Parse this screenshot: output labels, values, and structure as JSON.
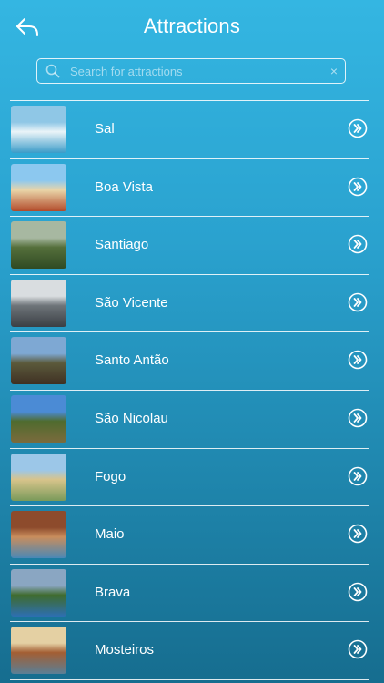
{
  "header": {
    "title": "Attractions",
    "back_icon": "back-arrow-icon"
  },
  "search": {
    "placeholder": "Search for attractions",
    "value": "",
    "clear_icon": "×"
  },
  "attractions": [
    {
      "name": "Sal",
      "thumb": [
        "#8fc7e6",
        "#eaf4f8",
        "#3a9bc8"
      ]
    },
    {
      "name": "Boa Vista",
      "thumb": [
        "#8cc8ef",
        "#e9d5a9",
        "#b24a2a"
      ]
    },
    {
      "name": "Santiago",
      "thumb": [
        "#a7b8a1",
        "#556f3b",
        "#2f4a24"
      ]
    },
    {
      "name": "São Vicente",
      "thumb": [
        "#d9dde0",
        "#6e7479",
        "#3a3f44"
      ]
    },
    {
      "name": "Santo Antão",
      "thumb": [
        "#7ea8d3",
        "#5b5a3b",
        "#3f3023"
      ]
    },
    {
      "name": "São Nicolau",
      "thumb": [
        "#4b8bd5",
        "#4f6b2e",
        "#7b6b3d"
      ]
    },
    {
      "name": "Fogo",
      "thumb": [
        "#9cc7e8",
        "#d8c48b",
        "#7a9a5a"
      ]
    },
    {
      "name": "Maio",
      "thumb": [
        "#8d4b2c",
        "#c98d5d",
        "#4a88b6"
      ]
    },
    {
      "name": "Brava",
      "thumb": [
        "#8aa6c2",
        "#3f6b2d",
        "#2d6fb3"
      ]
    },
    {
      "name": "Mosteiros",
      "thumb": [
        "#e4d0a3",
        "#a35e33",
        "#5a7f96"
      ]
    }
  ]
}
